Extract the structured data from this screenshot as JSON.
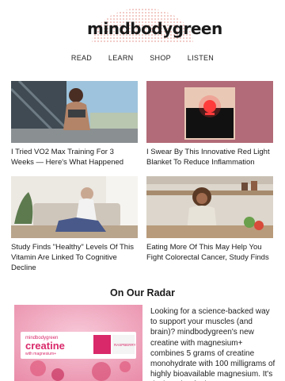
{
  "brand": {
    "name": "mindbodygreen"
  },
  "nav": {
    "items": [
      "READ",
      "LEARN",
      "SHOP",
      "LISTEN"
    ]
  },
  "articles": [
    {
      "title": "I Tried VO2 Max Training For 3 Weeks — Here's What Happened"
    },
    {
      "title": "I Swear By This Innovative Red Light Blanket To Reduce Inflammation"
    },
    {
      "title": "Study Finds \"Healthy\" Levels Of This Vitamin Are Linked To Cognitive Decline"
    },
    {
      "title": "Eating More Of This May Help You Fight Colorectal Cancer, Study Finds"
    }
  ],
  "radar": {
    "heading": "On Our Radar",
    "product": {
      "brand": "mindbodygreen",
      "name": "creatine",
      "sub": "with magnesium+",
      "flavor": "RASPBERRY"
    },
    "body": "Looking for a science-backed way to support your muscles (and brain)? mindbodygreen's new creatine with magnesium+ combines 5 grams of creatine monohydrate with 100 milligrams of highly bioavailable magnesium. It's designed to fuel"
  },
  "colors": {
    "accent": "#e8a7a0",
    "product_pink": "#d9296a",
    "red_light_bg": "#b26b78"
  }
}
